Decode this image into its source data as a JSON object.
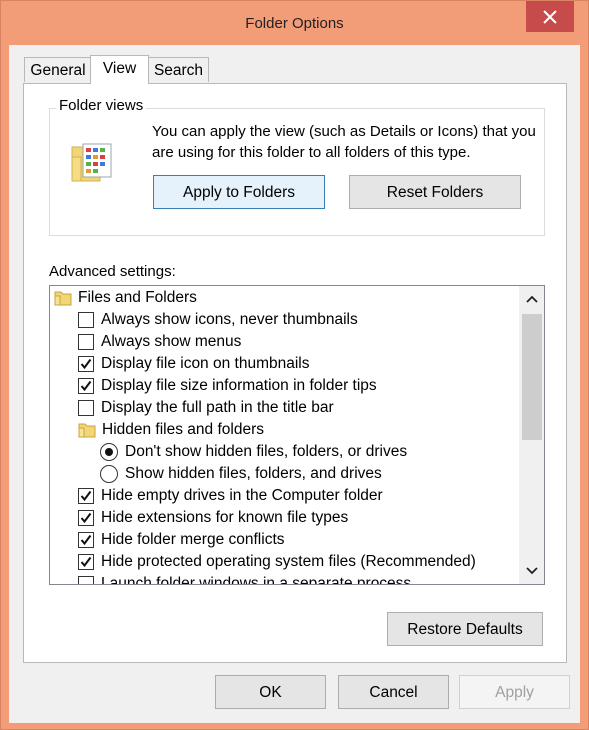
{
  "window": {
    "title": "Folder Options",
    "close_glyph": "✕"
  },
  "tabs": [
    {
      "label": "General",
      "active": false
    },
    {
      "label": "View",
      "active": true
    },
    {
      "label": "Search",
      "active": false
    }
  ],
  "folder_views": {
    "group_label": "Folder views",
    "icon": "folder-views-icon",
    "description": "You can apply the view (such as Details or Icons) that you are using for this folder to all folders of this type.",
    "apply_button": "Apply to Folders",
    "reset_button": "Reset Folders"
  },
  "advanced": {
    "label": "Advanced settings:",
    "items": [
      {
        "type": "folder",
        "label": "Files and Folders"
      },
      {
        "type": "checkbox",
        "label": "Always show icons, never thumbnails",
        "checked": false
      },
      {
        "type": "checkbox",
        "label": "Always show menus",
        "checked": false
      },
      {
        "type": "checkbox",
        "label": "Display file icon on thumbnails",
        "checked": true
      },
      {
        "type": "checkbox",
        "label": "Display file size information in folder tips",
        "checked": true
      },
      {
        "type": "checkbox",
        "label": "Display the full path in the title bar",
        "checked": false
      },
      {
        "type": "folder",
        "label": "Hidden files and folders"
      },
      {
        "type": "radio",
        "label": "Don't show hidden files, folders, or drives",
        "selected": true
      },
      {
        "type": "radio",
        "label": "Show hidden files, folders, and drives",
        "selected": false
      },
      {
        "type": "checkbox",
        "label": "Hide empty drives in the Computer folder",
        "checked": true
      },
      {
        "type": "checkbox",
        "label": "Hide extensions for known file types",
        "checked": true
      },
      {
        "type": "checkbox",
        "label": "Hide folder merge conflicts",
        "checked": true
      },
      {
        "type": "checkbox",
        "label": "Hide protected operating system files (Recommended)",
        "checked": true
      },
      {
        "type": "checkbox",
        "label": "Launch folder windows in a separate process",
        "checked": false
      }
    ]
  },
  "restore_defaults_button": "Restore Defaults",
  "footer": {
    "ok": "OK",
    "cancel": "Cancel",
    "apply": "Apply",
    "apply_enabled": false
  },
  "colors": {
    "title_bar": "#f29c78",
    "close_button": "#c74b4b",
    "focused_button_border": "#3c7fb1"
  }
}
